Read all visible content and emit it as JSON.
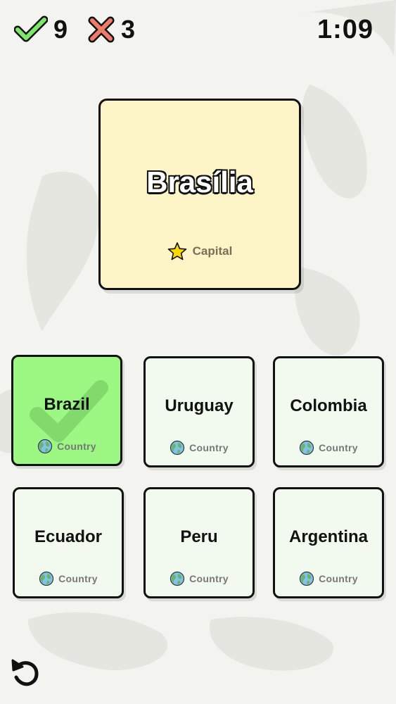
{
  "hud": {
    "correct_count": "9",
    "wrong_count": "3",
    "timer": "1:09",
    "correct_icon": "checkmark-icon",
    "wrong_icon": "cross-icon"
  },
  "prompt": {
    "title": "Brasília",
    "type_label": "Capital",
    "type_icon": "star-icon"
  },
  "options": [
    {
      "label": "Brazil",
      "type_label": "Country",
      "state": "correct"
    },
    {
      "label": "Uruguay",
      "type_label": "Country",
      "state": "default"
    },
    {
      "label": "Colombia",
      "type_label": "Country",
      "state": "default"
    },
    {
      "label": "Ecuador",
      "type_label": "Country",
      "state": "default"
    },
    {
      "label": "Peru",
      "type_label": "Country",
      "state": "default"
    },
    {
      "label": "Argentina",
      "type_label": "Country",
      "state": "default"
    }
  ],
  "option_icon": "globe-icon",
  "footer": {
    "restart_icon": "restart-icon"
  },
  "colors": {
    "correct_green": "#9cf783",
    "prompt_bg": "#fdf4c8",
    "option_bg": "#f2faf0",
    "star": "#ffd600",
    "wrong_red": "#ee7b6b"
  }
}
